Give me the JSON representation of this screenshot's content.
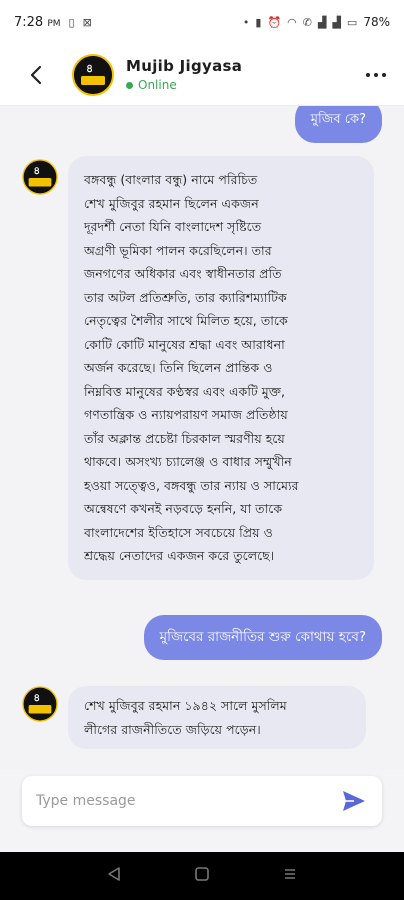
{
  "status_bar": {
    "time": "7:28",
    "time_suffix": "PM",
    "battery": "78%"
  },
  "header": {
    "contact_name": "Mujib Jigyasa",
    "presence": "Online",
    "presence_color": "#3aa853"
  },
  "messages": [
    {
      "from": "user",
      "text": "মুজিব কে?"
    },
    {
      "from": "bot",
      "lines": [
        "বঙ্গবন্ধু (বাংলার বন্ধু) নামে পরিচিত",
        "শেখ মুজিবুর রহমান ছিলেন একজন",
        "দূরদর্শী নেতা যিনি বাংলাদেশ সৃষ্টিতে",
        "অগ্রণী ভূমিকা পালন করেছিলেন। তার",
        "জনগণের অধিকার এবং স্বাধীনতার প্রতি",
        "তার অটল প্রতিশ্রুতি, তার ক্যারিশম্যাটিক",
        "নেতৃত্বের শৈলীর সাথে মিলিত হয়ে, তাকে",
        "কোটি কোটি মানুষের শ্রদ্ধা এবং আরাধনা",
        "অর্জন করেছে। তিনি ছিলেন প্রান্তিক ও",
        "নিম্নবিত্ত মানুষের কণ্ঠস্বর এবং একটি মুক্ত,",
        "গণতান্ত্রিক ও ন্যায়পরায়ণ সমাজ প্রতিষ্ঠায়",
        "তাঁর অক্লান্ত প্রচেষ্টা চিরকাল স্মরণীয় হয়ে",
        "থাকবে। অসংখ্য চ্যালেঞ্জ ও বাধার সম্মুখীন",
        "হওয়া সত্ত্বেও, বঙ্গবন্ধু তার ন্যায় ও সাম্যের",
        "অন্বেষণে কখনই নড়বড়ে হননি, যা তাকে",
        "বাংলাদেশের ইতিহাসে সবচেয়ে প্রিয় ও",
        "শ্রদ্ধেয় নেতাদের একজন করে তুলেছে।"
      ]
    },
    {
      "from": "user",
      "text": "মুজিবের রাজনীতির শুরু কোথায় হবে?"
    },
    {
      "from": "bot",
      "lines": [
        "শেখ মুজিবুর রহমান ১৯৪২ সালে মুসলিম",
        "লীগের রাজনীতিতে জড়িয়ে পড়েন।"
      ]
    }
  ],
  "composer": {
    "placeholder": "Type message"
  },
  "colors": {
    "user_bubble": "#7b88e6",
    "bot_bubble": "#e8e8f3",
    "send_icon": "#5a67d8"
  }
}
